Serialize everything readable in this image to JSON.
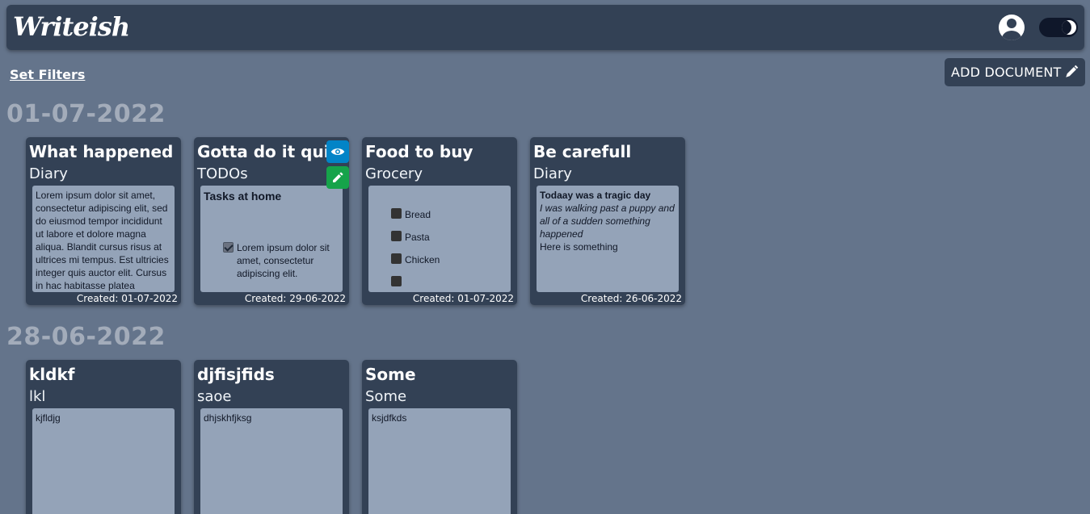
{
  "navbar": {
    "brand": "Writeish",
    "user_icon": "user-circle-icon",
    "theme_icon": "moon-icon"
  },
  "toolbar": {
    "set_filters": "Set Filters",
    "add_document": "ADD DOCUMENT",
    "add_document_icon": "pen-icon"
  },
  "groups": [
    {
      "date": "01-07-2022",
      "cards": [
        {
          "title": "What happened",
          "category": "Diary",
          "preview_text": "Lorem ipsum dolor sit amet, consectetur adipiscing elit, sed do eiusmod tempor incididunt ut labore et dolore magna aliqua. Blandit cursus risus at ultrices mi tempus. Est ultricies integer quis auctor elit. Cursus in hac habitasse platea",
          "created": "Created: 01-07-2022"
        },
        {
          "title": "Gotta do it quick",
          "category": "TODOs",
          "preview_title": "Tasks at home",
          "todo_item": "Lorem ipsum dolor sit amet, consectetur adipiscing elit.",
          "todo_checked": true,
          "created": "Created: 29-06-2022"
        },
        {
          "title": "Food to buy",
          "category": "Grocery",
          "items": [
            "Bread",
            "Pasta",
            "Chicken"
          ],
          "created": "Created: 01-07-2022"
        },
        {
          "title": "Be carefull",
          "category": "Diary",
          "preview_title": "Todaay was a tragic day",
          "preview_italic": "I was walking past a puppy and all of a sudden something happened",
          "preview_text": "Here is something",
          "created": "Created: 26-06-2022"
        }
      ]
    },
    {
      "date": "28-06-2022",
      "cards": [
        {
          "title": "kldkf",
          "category": "lkl",
          "preview_text": "kjfldjg"
        },
        {
          "title": "djfisjfids",
          "category": "saoe",
          "preview_text": "dhjskhfjksg"
        },
        {
          "title": "Some",
          "category": "Some",
          "preview_text": "ksjdfkds"
        }
      ]
    }
  ],
  "card_actions": {
    "view_icon": "eye-icon",
    "edit_icon": "pencil-icon",
    "view_color": "#0284c7",
    "edit_color": "#16a34a"
  },
  "colors": {
    "background": "#64748b",
    "surface": "#334155",
    "preview": "#94a3b8",
    "date_header": "#a3acba"
  }
}
